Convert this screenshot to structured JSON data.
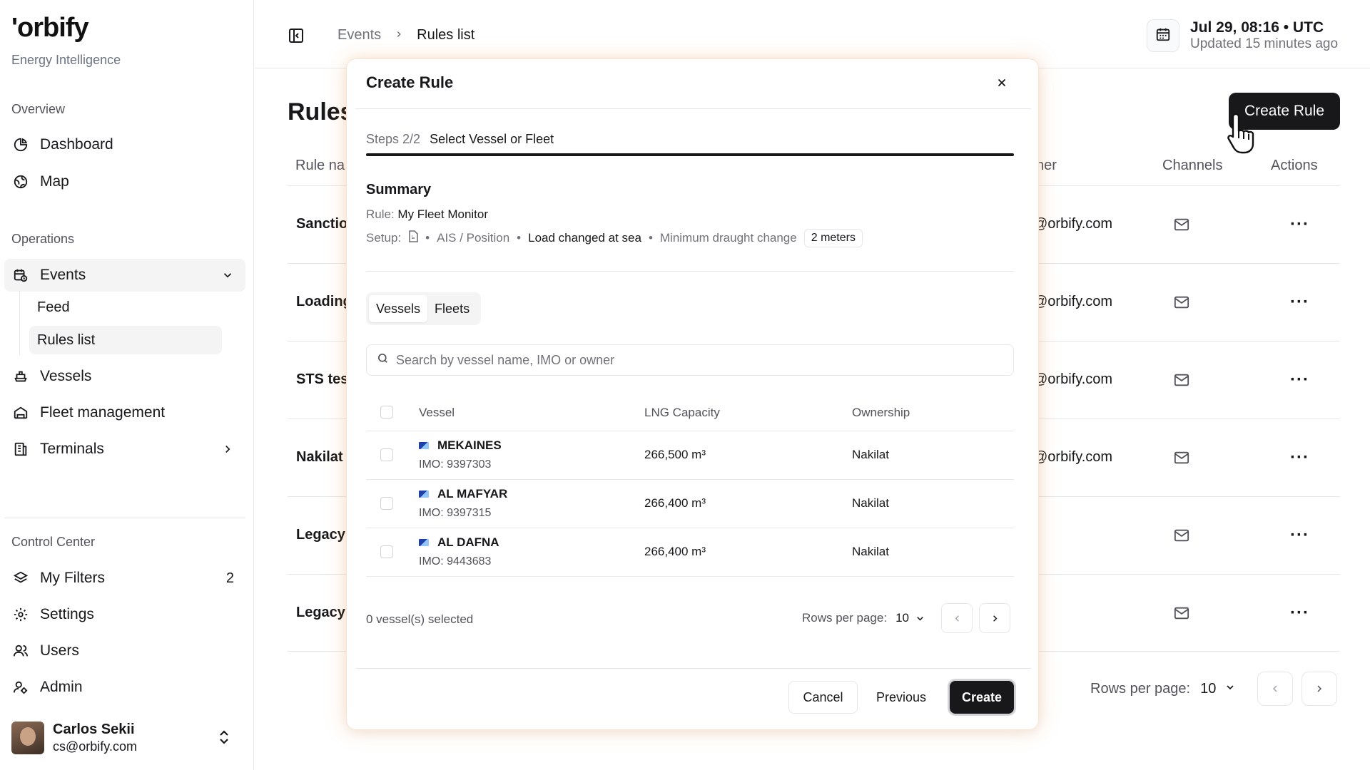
{
  "brand": {
    "logo": "'orbify",
    "tagline": "Energy Intelligence"
  },
  "sidebar": {
    "overview_label": "Overview",
    "overview_items": [
      {
        "label": "Dashboard",
        "icon": "pie-chart-icon"
      },
      {
        "label": "Map",
        "icon": "globe-icon"
      }
    ],
    "operations_label": "Operations",
    "events": {
      "label": "Events",
      "icon": "calendar-clock-icon"
    },
    "events_sub": [
      {
        "label": "Feed"
      },
      {
        "label": "Rules list"
      }
    ],
    "operations_items": [
      {
        "label": "Vessels",
        "icon": "ship-icon"
      },
      {
        "label": "Fleet management",
        "icon": "fleet-icon"
      },
      {
        "label": "Terminals",
        "icon": "terminal-icon"
      }
    ],
    "control_label": "Control Center",
    "control_items": [
      {
        "label": "My Filters",
        "icon": "layers-icon",
        "count": "2"
      },
      {
        "label": "Settings",
        "icon": "gear-icon"
      },
      {
        "label": "Users",
        "icon": "users-icon"
      },
      {
        "label": "Admin",
        "icon": "admin-icon"
      }
    ],
    "user": {
      "name": "Carlos Sekii",
      "email": "cs@orbify.com"
    }
  },
  "header": {
    "breadcrumb": [
      "Events",
      "Rules list"
    ],
    "date": "Jul 29, 08:16 • UTC",
    "updated": "Updated 15 minutes ago"
  },
  "main": {
    "title": "Rules",
    "create_button": "Create Rule",
    "columns": {
      "rule_name": "Rule na",
      "owner": "ner",
      "channels": "Channels",
      "actions": "Actions"
    },
    "rows": [
      {
        "name": "Sanctio",
        "owner": "@orbify.com"
      },
      {
        "name": "Loading",
        "owner": "@orbify.com"
      },
      {
        "name": "STS tes",
        "owner": "@orbify.com"
      },
      {
        "name": "Nakilat",
        "owner": "@orbify.com"
      },
      {
        "name": "Legacy",
        "owner": ""
      },
      {
        "name": "Legacy",
        "owner": ""
      }
    ],
    "pagination": {
      "label": "Rows per page:",
      "value": "10"
    }
  },
  "modal": {
    "title": "Create Rule",
    "steps": "Steps 2/2",
    "step_title": "Select Vessel or Fleet",
    "progress_percent": 100,
    "summary_heading": "Summary",
    "rule_key": "Rule:",
    "rule_value": "My Fleet Monitor",
    "setup_key": "Setup:",
    "setup_source": "AIS / Position",
    "setup_event": "Load changed at sea",
    "setup_param": "Minimum draught change",
    "setup_badge": "2 meters",
    "tabs": [
      "Vessels",
      "Fleets"
    ],
    "search_placeholder": "Search by vessel name, IMO or owner",
    "table_headers": {
      "vessel": "Vessel",
      "capacity": "LNG Capacity",
      "ownership": "Ownership"
    },
    "vessels": [
      {
        "name": "MEKAINES",
        "imo": "IMO: 9397303",
        "capacity": "266,500 m³",
        "ownership": "Nakilat"
      },
      {
        "name": "AL MAFYAR",
        "imo": "IMO: 9397315",
        "capacity": "266,400 m³",
        "ownership": "Nakilat"
      },
      {
        "name": "AL DAFNA",
        "imo": "IMO: 9443683",
        "capacity": "266,400 m³",
        "ownership": "Nakilat"
      }
    ],
    "selected_text": "0 vessel(s) selected",
    "rows_per_page_label": "Rows per page:",
    "rows_per_page_value": "10",
    "cancel": "Cancel",
    "previous": "Previous",
    "create": "Create"
  }
}
